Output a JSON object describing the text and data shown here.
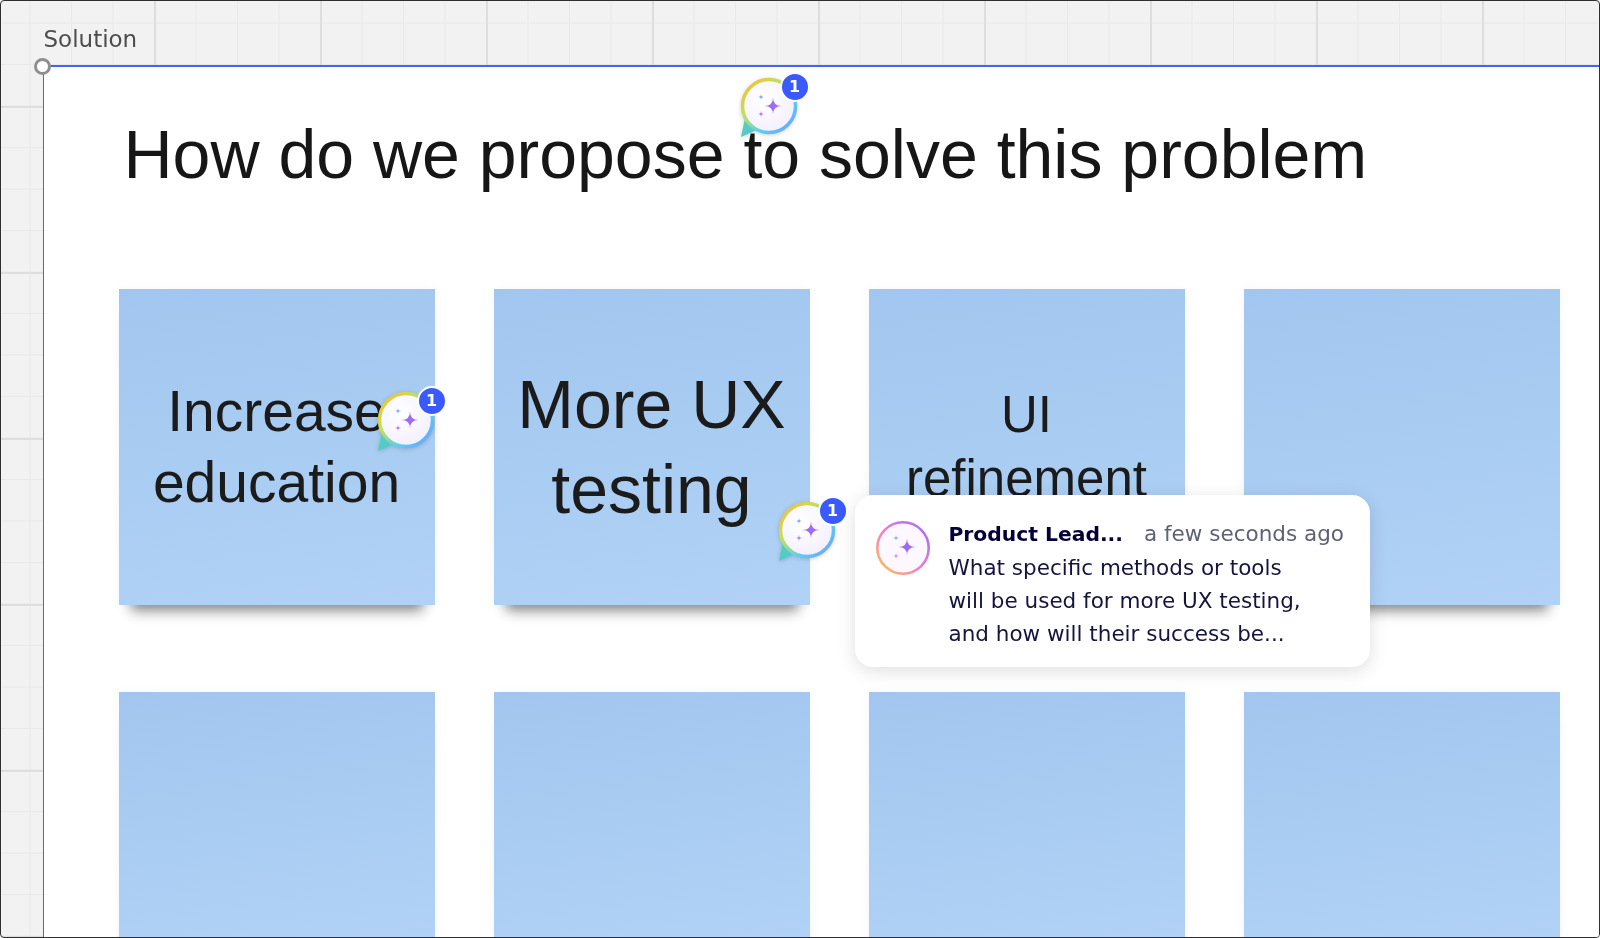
{
  "frame": {
    "title": "Solution",
    "heading": {
      "text": "How do we propose to solve this problem",
      "comment_count": "1"
    },
    "sticky_notes": [
      {
        "kind": "text",
        "text": "Increase education",
        "comment_count": "1"
      },
      {
        "kind": "text",
        "text": "More UX testing",
        "comment_count": "1"
      },
      {
        "kind": "text",
        "text": "UI refinement"
      },
      {
        "kind": "blank"
      },
      {
        "kind": "blank"
      },
      {
        "kind": "blank"
      },
      {
        "kind": "blank"
      },
      {
        "kind": "blank"
      }
    ],
    "comment_popup": {
      "author": "Product Lead...",
      "time": "a few seconds ago",
      "text": "What specific methods or tools will be used for more UX testing, and how will their success be..."
    }
  }
}
